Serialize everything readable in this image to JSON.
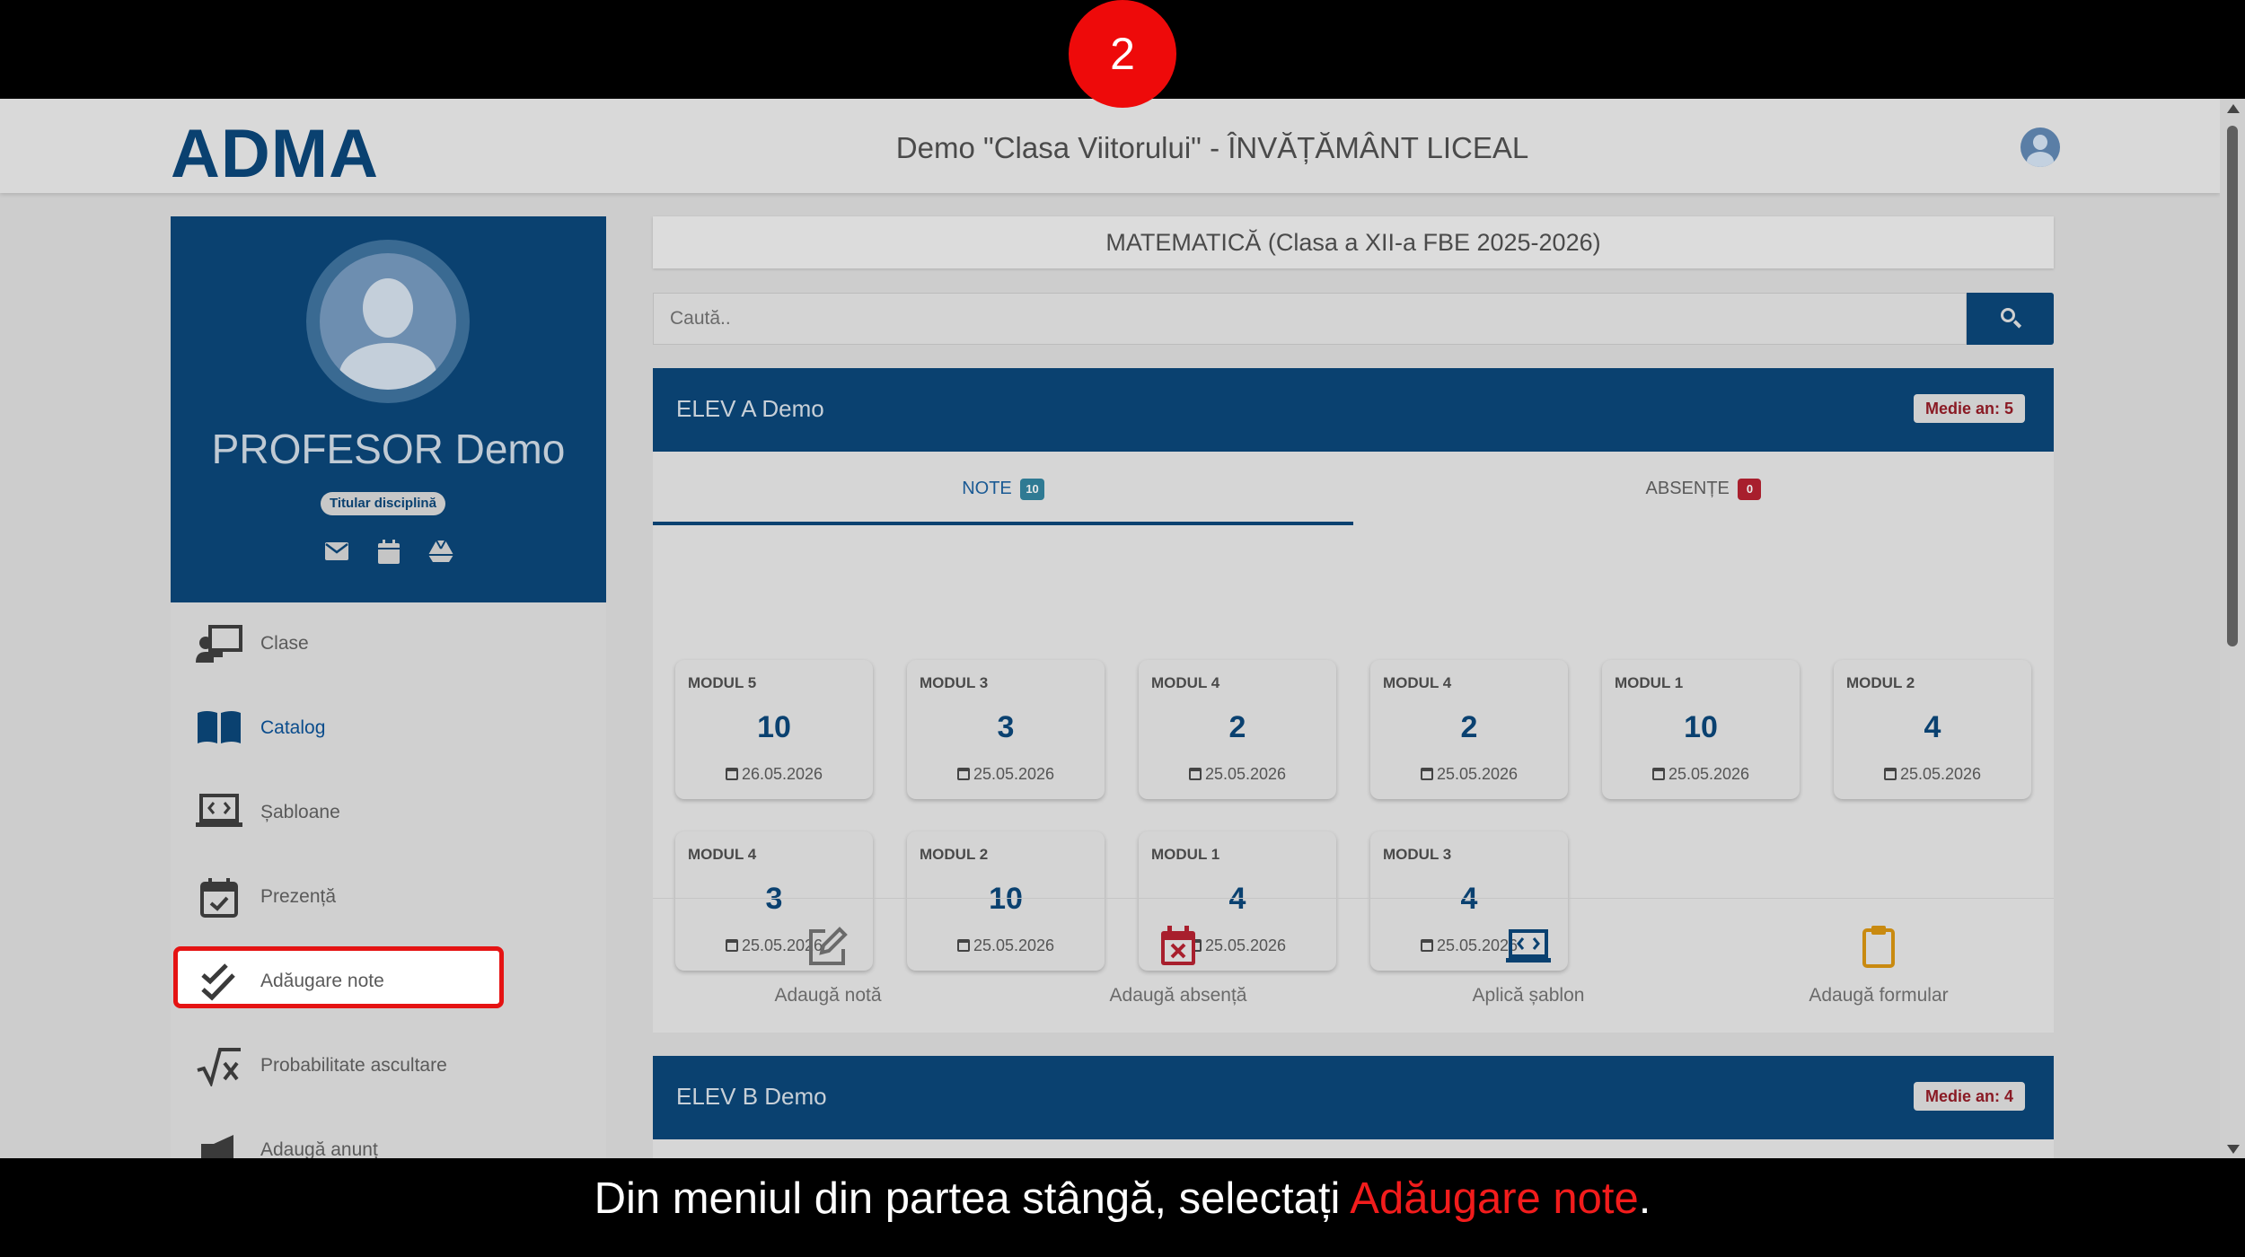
{
  "step": {
    "number": "2"
  },
  "app": {
    "logo": "ADMA",
    "title": "Demo \"Clasa Viitorului\" - ÎNVĂȚĂMÂNT LICEAL"
  },
  "profile": {
    "name": "PROFESOR Demo",
    "role": "Titular disciplină",
    "icons": [
      "envelope-icon",
      "calendar-icon",
      "drive-icon"
    ]
  },
  "sidebar": {
    "items": [
      {
        "label": "Clase",
        "icon": "classroom-icon"
      },
      {
        "label": "Catalog",
        "icon": "book-icon",
        "active": true
      },
      {
        "label": "Șabloane",
        "icon": "laptop-code-icon"
      },
      {
        "label": "Prezență",
        "icon": "calendar-check-icon"
      },
      {
        "label": "Adăugare note",
        "icon": "double-check-icon",
        "highlighted": true
      },
      {
        "label": "Probabilitate ascultare",
        "icon": "square-root-icon"
      },
      {
        "label": "Adaugă anunț",
        "icon": "megaphone-icon"
      }
    ]
  },
  "main": {
    "subject": "MATEMATICĂ (Clasa a XII-a FBE 2025-2026)",
    "search": {
      "placeholder": "Caută.."
    },
    "students": [
      {
        "name": "ELEV A Demo",
        "average": "Medie an: 5",
        "tabs": [
          {
            "label": "NOTE",
            "count": "10"
          },
          {
            "label": "ABSENȚE",
            "count": "0"
          }
        ],
        "grades": [
          {
            "module": "MODUL 5",
            "value": "10",
            "date": "26.05.2026"
          },
          {
            "module": "MODUL 3",
            "value": "3",
            "date": "25.05.2026"
          },
          {
            "module": "MODUL 4",
            "value": "2",
            "date": "25.05.2026"
          },
          {
            "module": "MODUL 4",
            "value": "2",
            "date": "25.05.2026"
          },
          {
            "module": "MODUL 1",
            "value": "10",
            "date": "25.05.2026"
          },
          {
            "module": "MODUL 2",
            "value": "4",
            "date": "25.05.2026"
          },
          {
            "module": "MODUL 4",
            "value": "3",
            "date": "25.05.2026"
          },
          {
            "module": "MODUL 2",
            "value": "10",
            "date": "25.05.2026"
          },
          {
            "module": "MODUL 1",
            "value": "4",
            "date": "25.05.2026"
          },
          {
            "module": "MODUL 3",
            "value": "4",
            "date": "25.05.2026"
          }
        ],
        "actions": [
          {
            "label": "Adaugă notă",
            "icon": "edit-icon",
            "color": "#6a6a6a"
          },
          {
            "label": "Adaugă absență",
            "icon": "calendar-x-icon",
            "color": "#a81f2d"
          },
          {
            "label": "Aplică șablon",
            "icon": "laptop-code-icon",
            "color": "#0a4170"
          },
          {
            "label": "Adaugă formular",
            "icon": "clipboard-icon",
            "color": "#c98a10"
          }
        ]
      },
      {
        "name": "ELEV B Demo",
        "average": "Medie an: 4"
      }
    ]
  },
  "caption": {
    "prefix": "Din meniul din partea stângă, selectați ",
    "highlight": "Adăugare note",
    "suffix": "."
  },
  "colors": {
    "brand": "#0a4170",
    "highlight": "#e51313",
    "step_badge": "#ee0a0a"
  }
}
